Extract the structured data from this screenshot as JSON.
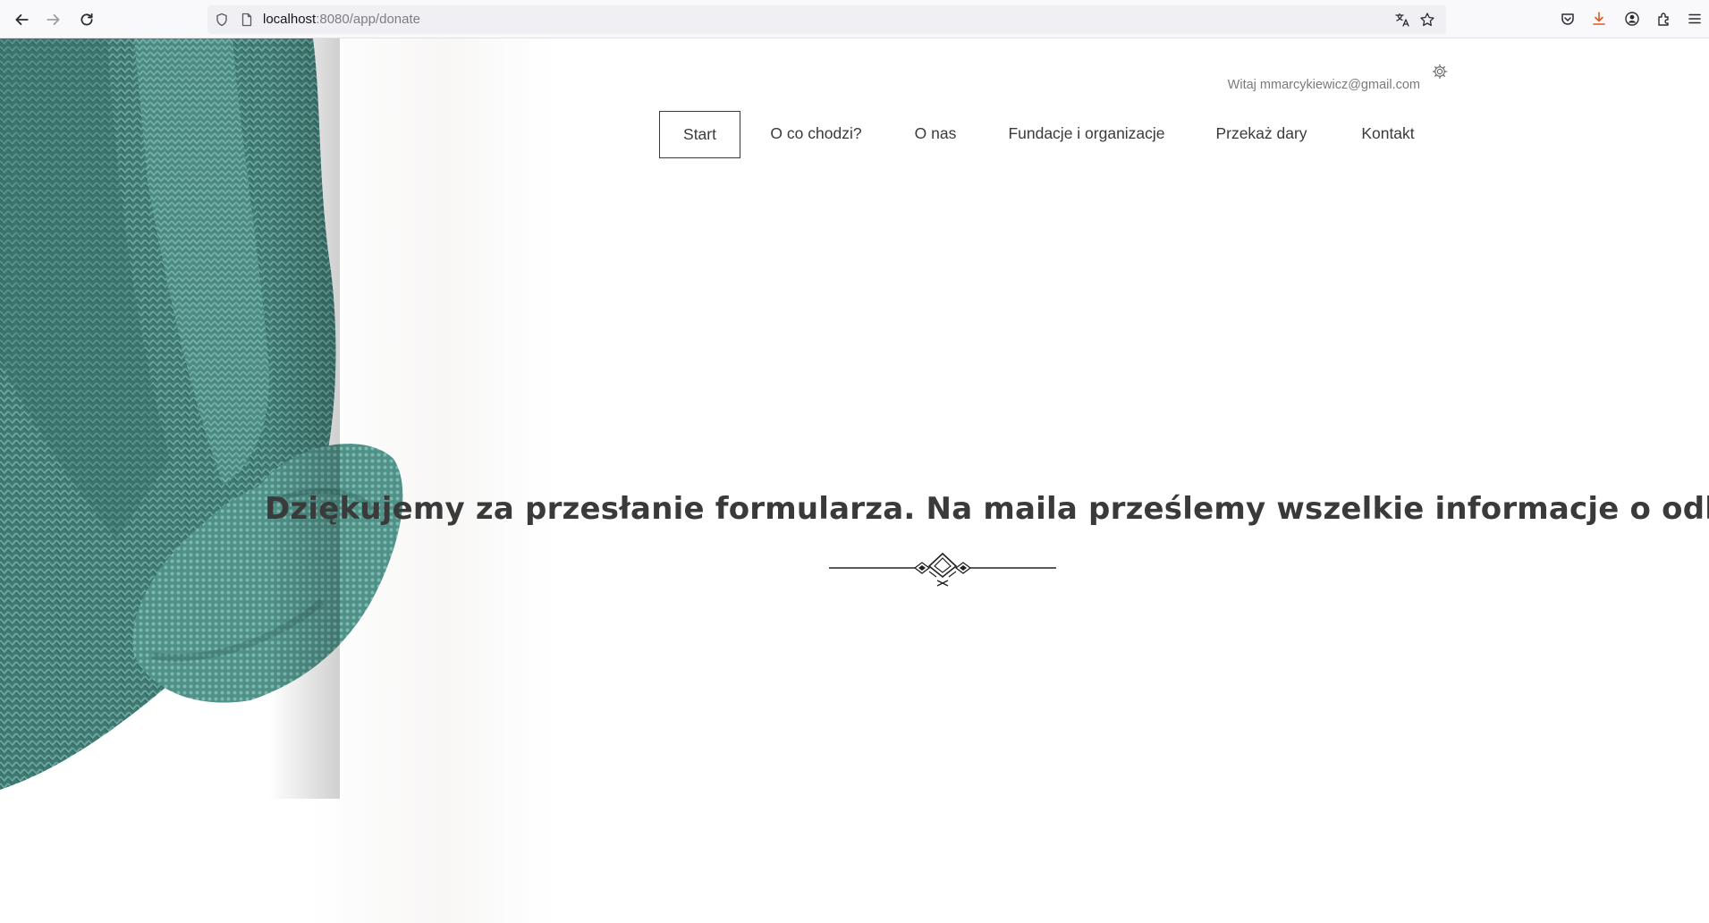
{
  "browser": {
    "url_host": "localhost",
    "url_path": ":8080/app/donate"
  },
  "header": {
    "greeting": "Witaj mmarcykiewicz@gmail.com"
  },
  "nav": {
    "items": [
      {
        "label": "Start",
        "active": true
      },
      {
        "label": "O co chodzi?",
        "active": false
      },
      {
        "label": "O nas",
        "active": false
      },
      {
        "label": "Fundacje i organizacje",
        "active": false
      },
      {
        "label": "Przekaż dary",
        "active": false
      },
      {
        "label": "Kontakt",
        "active": false
      }
    ]
  },
  "main": {
    "message": "Dziękujemy za przesłanie formularza. Na maila prześlemy wszelkie informacje o odbiorze."
  },
  "icons": {
    "back": "arrow-left-icon",
    "forward": "arrow-right-icon",
    "reload": "reload-icon",
    "shield": "shield-icon",
    "page": "page-icon",
    "translate": "translate-icon",
    "bookmark": "star-icon",
    "pocket": "pocket-icon",
    "downloads": "download-icon",
    "account": "account-icon",
    "extensions": "extensions-icon",
    "menu": "hamburger-menu-icon",
    "settings": "gear-icon"
  },
  "colors": {
    "text": "#3a3a3a",
    "sweater": "#4a857d",
    "download_accent": "#e25920"
  }
}
